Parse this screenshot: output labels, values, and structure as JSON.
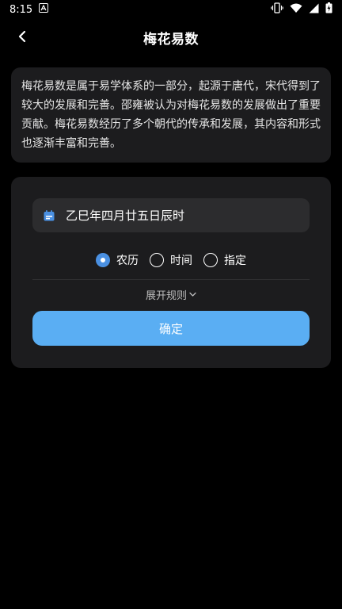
{
  "status_bar": {
    "time": "8:15"
  },
  "app_bar": {
    "title": "梅花易数"
  },
  "intro": {
    "text": "梅花易数是属于易学体系的一部分，起源于唐代，宋代得到了较大的发展和完善。邵雍被认为对梅花易数的发展做出了重要贡献。梅花易数经历了多个朝代的传承和发展，其内容和形式也逐渐丰富和完善。"
  },
  "form": {
    "date_value": "乙巳年四月廿五日辰时",
    "radio_options": [
      {
        "label": "农历",
        "checked": true
      },
      {
        "label": "时间",
        "checked": false
      },
      {
        "label": "指定",
        "checked": false
      }
    ],
    "expand_label": "展开规则",
    "confirm_label": "确定"
  },
  "colors": {
    "background": "#000000",
    "card": "#1c1c1e",
    "input": "#2c2c2e",
    "accent": "#5aaef3",
    "radio_checked": "#4a90e2"
  }
}
